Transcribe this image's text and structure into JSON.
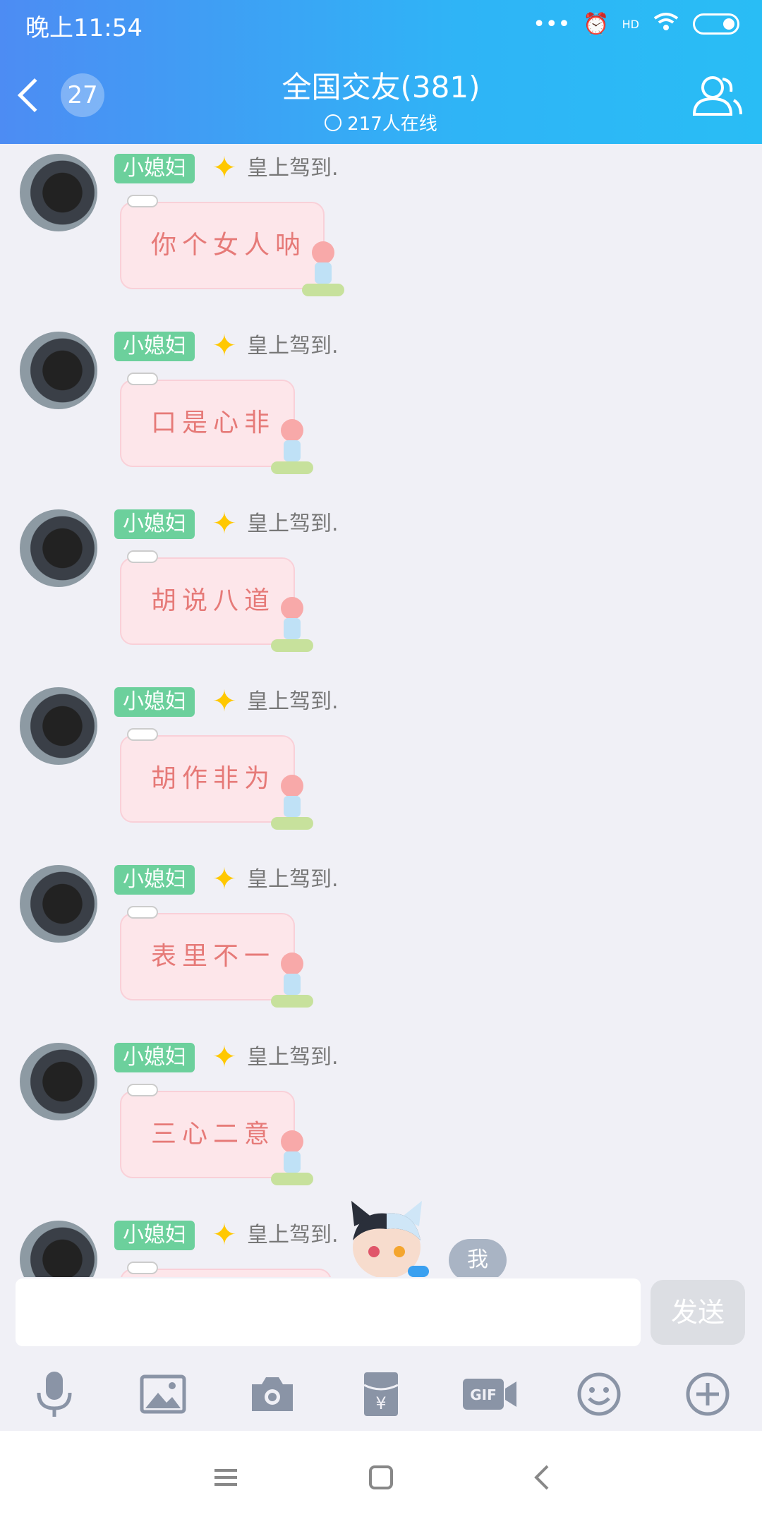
{
  "status_bar": {
    "time": "晚上11:54",
    "signal_text": "HD"
  },
  "header": {
    "back_count": "27",
    "title": "全国交友(381)",
    "subtitle": "217人在线"
  },
  "messages": [
    {
      "tag": "小媳妇",
      "sender": "皇上驾到.",
      "text": "你个女人呐"
    },
    {
      "tag": "小媳妇",
      "sender": "皇上驾到.",
      "text": "口是心非"
    },
    {
      "tag": "小媳妇",
      "sender": "皇上驾到.",
      "text": "胡说八道"
    },
    {
      "tag": "小媳妇",
      "sender": "皇上驾到.",
      "text": "胡作非为"
    },
    {
      "tag": "小媳妇",
      "sender": "皇上驾到.",
      "text": "表里不一"
    },
    {
      "tag": "小媳妇",
      "sender": "皇上驾到.",
      "text": "三心二意"
    },
    {
      "tag": "小媳妇",
      "sender": "皇上驾到.",
      "text": ""
    }
  ],
  "quick_reply": "我",
  "input": {
    "send_label": "发送"
  },
  "toolbar_icons": [
    "microphone-icon",
    "image-icon",
    "camera-icon",
    "red-packet-icon",
    "gif-icon",
    "emoji-icon",
    "plus-icon"
  ],
  "colors": {
    "header_start": "#4d8cf3",
    "header_end": "#29bdf5",
    "tag_green": "#6cd09c",
    "bubble_pink": "#fde6ea",
    "bubble_text": "#e67a78"
  }
}
